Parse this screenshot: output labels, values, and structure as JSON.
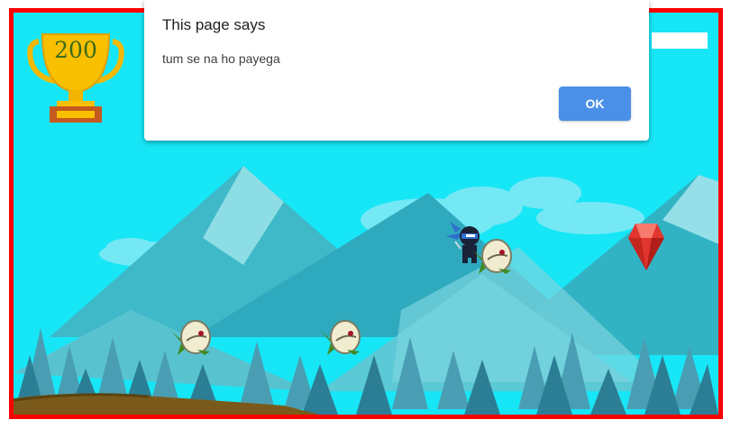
{
  "dialog": {
    "title": "This page says",
    "message": "tum se na ho payega",
    "ok_label": "OK",
    "accent_color": "#4a8fe8"
  },
  "game": {
    "score": "200",
    "border_color": "#ff0000",
    "sky_color": "#17e6f7",
    "player_icon": "ninja-icon",
    "enemy_icon": "flying-bird-enemy-icon",
    "collectible_icon": "red-gem-icon",
    "score_icon": "trophy-icon"
  }
}
